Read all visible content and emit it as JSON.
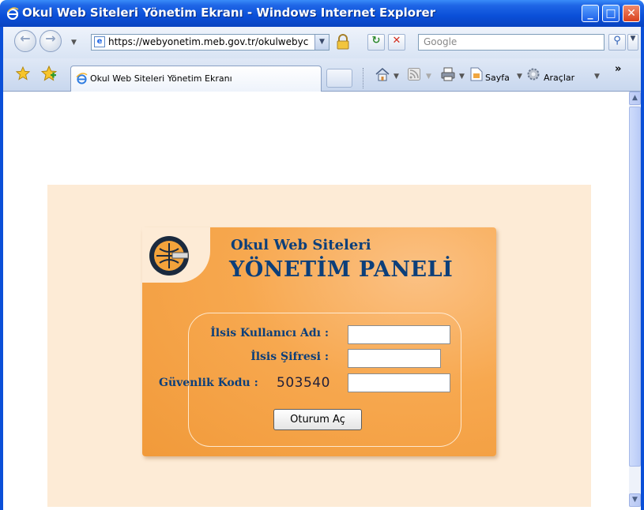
{
  "window": {
    "title": "Okul Web Siteleri Yönetim Ekranı - Windows Internet Explorer",
    "minimize_label": "_",
    "maximize_label": "□",
    "close_label": "✕"
  },
  "nav": {
    "url": "https://webyonetim.meb.gov.tr/okulwebyc",
    "search_placeholder": "Google"
  },
  "tabs": [
    {
      "label": "Okul Web Siteleri Yönetim Ekranı"
    }
  ],
  "toolbar": {
    "page_label": "Sayfa",
    "tools_label": "Araçlar",
    "more_label": "»"
  },
  "panel": {
    "title_line1": "Okul Web Siteleri",
    "title_line2": "YÖNETİM PANELİ",
    "username_label": "İlsis Kullanıcı Adı :",
    "password_label": "İlsis Şifresi :",
    "security_label": "Güvenlik Kodu :",
    "security_code": "503540",
    "submit_label": "Oturum Aç"
  },
  "colors": {
    "panel_orange": "#f7a84f",
    "panel_text": "#0c3f7a",
    "page_bg": "#fdebd6",
    "titlebar_blue": "#0a4fd8"
  }
}
